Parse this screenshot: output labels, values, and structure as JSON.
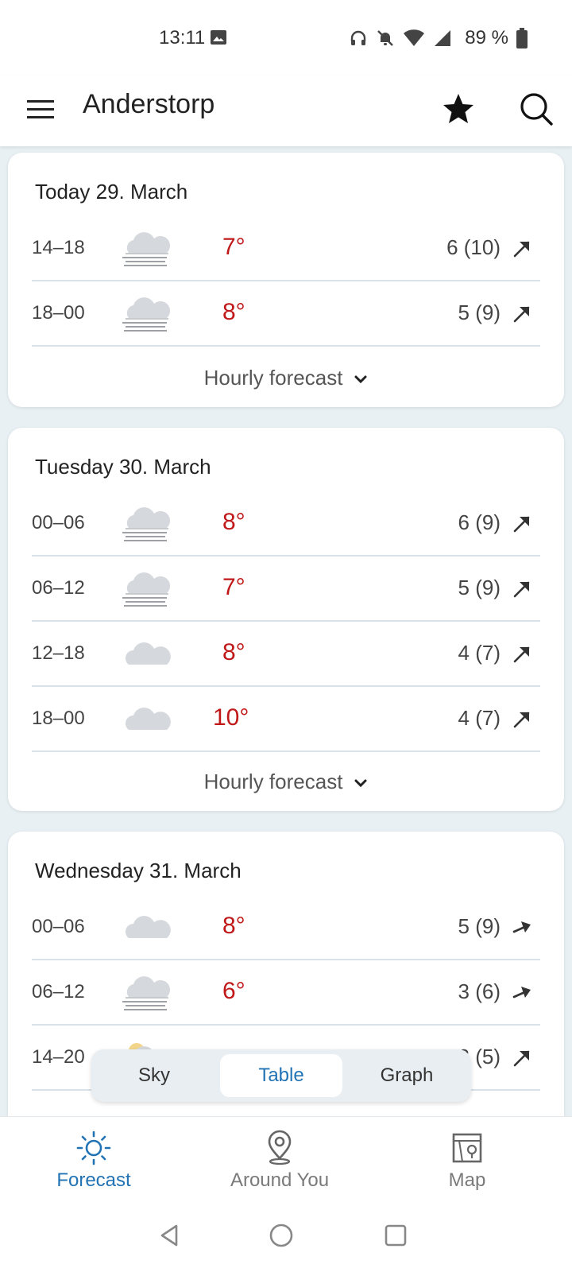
{
  "status_bar": {
    "time": "13:11",
    "battery_text": "89 %"
  },
  "app_bar": {
    "location": "Anderstorp"
  },
  "days": [
    {
      "date": "Today 29. March",
      "rows": [
        {
          "time": "14–18",
          "icon": "cloud-fog-icon",
          "temp": "7°",
          "wind": "6 (10)"
        },
        {
          "time": "18–00",
          "icon": "cloud-fog-icon",
          "temp": "8°",
          "wind": "5 (9)"
        }
      ],
      "hourly_label": "Hourly forecast"
    },
    {
      "date": "Tuesday 30. March",
      "rows": [
        {
          "time": "00–06",
          "icon": "cloud-fog-icon",
          "temp": "8°",
          "wind": "6 (9)"
        },
        {
          "time": "06–12",
          "icon": "cloud-fog-icon",
          "temp": "7°",
          "wind": "5 (9)"
        },
        {
          "time": "12–18",
          "icon": "cloud-icon",
          "temp": "8°",
          "wind": "4 (7)"
        },
        {
          "time": "18–00",
          "icon": "cloud-icon",
          "temp": "10°",
          "wind": "4 (7)"
        }
      ],
      "hourly_label": "Hourly forecast"
    },
    {
      "date": "Wednesday 31. March",
      "rows": [
        {
          "time": "00–06",
          "icon": "cloud-icon",
          "temp": "8°",
          "wind": "5 (9)"
        },
        {
          "time": "06–12",
          "icon": "cloud-fog-icon",
          "temp": "6°",
          "wind": "3 (6)"
        },
        {
          "time": "14–20",
          "icon": "partly-cloudy-icon",
          "temp": "",
          "wind": "3 (5)"
        }
      ]
    }
  ],
  "view_toggle": {
    "sky": "Sky",
    "table": "Table",
    "graph": "Graph",
    "selected": "Table"
  },
  "bottom_nav": {
    "forecast": "Forecast",
    "around_you": "Around You",
    "map": "Map",
    "active": "Forecast"
  },
  "colors": {
    "temp_warm": "#c01818",
    "accent": "#2273b4",
    "background": "#e9f0f4"
  }
}
